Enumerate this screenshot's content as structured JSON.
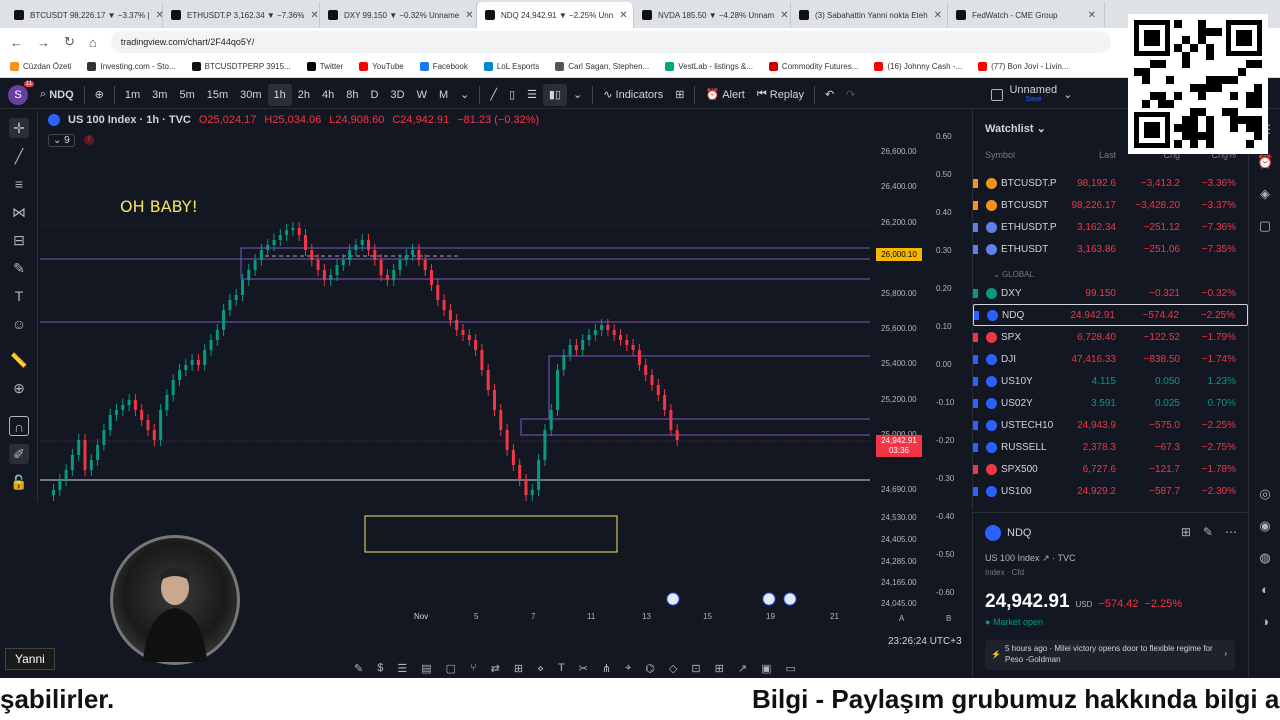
{
  "browser": {
    "tabs": [
      {
        "title": "BTCUSDT 98,226.17 ▼ −3.37% |",
        "active": false
      },
      {
        "title": "ETHUSDT.P 3,162.34 ▼ −7.36%",
        "active": false
      },
      {
        "title": "DXY 99.150 ▼ −0.32% Unname",
        "active": false
      },
      {
        "title": "NDQ 24,942.91 ▼ −2.25% Unn",
        "active": true
      },
      {
        "title": "NVDA 185.50 ▼ −4.28% Unnam",
        "active": false
      },
      {
        "title": "(3) Sabahattin Yanni nokta Eteh",
        "active": false
      },
      {
        "title": "FedWatch - CME Group",
        "active": false
      }
    ],
    "url": "tradingview.com/chart/2F44qo5Y/",
    "bookmarks": [
      "Cüzdan Özeti",
      "Investing.com - Sto...",
      "BTCUSDTPERP 3915...",
      "Twitter",
      "YouTube",
      "Facebook",
      "LoL Esports",
      "Carl Sagan, Stephen...",
      "VestLab - listings &...",
      "Commodity Futures...",
      "(16) Johnny Cash -...",
      "(77) Bon Jovi - Livin..."
    ]
  },
  "toolbar": {
    "avatar_letter": "S",
    "avatar_badge": "11",
    "symbol": "NDQ",
    "intervals": [
      "1m",
      "3m",
      "5m",
      "15m",
      "30m",
      "1h",
      "2h",
      "4h",
      "8h",
      "D",
      "3D",
      "W",
      "M"
    ],
    "selected_interval": "1h",
    "indicators_label": "Indicators",
    "alert_label": "Alert",
    "replay_label": "Replay",
    "layout_name": "Unnamed",
    "layout_status": "Save"
  },
  "chart": {
    "title": "US 100 Index · 1h · TVC",
    "ohlc": {
      "o": "O25,024.17",
      "h": "H25,034.06",
      "l": "L24,908.60",
      "c": "C24,942.91",
      "chg": "−81.23 (−0.32%)"
    },
    "indicator_count": "9",
    "annotation_text": "OH BABY!",
    "price_labels": [
      "26,600.00",
      "26,400.00",
      "26,200.00",
      "25,800.00",
      "25,600.00",
      "25,400.00",
      "25,200.00",
      "25,000.00",
      "24,690.00",
      "24,530.00",
      "24,405.00",
      "24,285.00",
      "24,165.00",
      "24,045.00"
    ],
    "pct_labels": [
      "0.60",
      "0.50",
      "0.40",
      "0.30",
      "0.20",
      "0.10",
      "0.00",
      "-0.10",
      "-0.20",
      "-0.30",
      "-0.40",
      "-0.50",
      "-0.60"
    ],
    "tag_level": "26,000.10",
    "tag_last_price": "24,942.91",
    "tag_countdown": "03:36",
    "time_labels": [
      "Nov",
      "5",
      "7",
      "11",
      "13",
      "15",
      "19",
      "21"
    ],
    "clock": "23:26:24 UTC+3",
    "colors": {
      "up": "#089981",
      "down": "#f23645",
      "box": "#7e57c2",
      "yellow": "#f5e663"
    }
  },
  "watchlist": {
    "title": "Watchlist",
    "columns": [
      "Symbol",
      "Last",
      "Chg",
      "Chg%"
    ],
    "global_label": "GLOBAL",
    "rows": [
      {
        "symbol": "BTCUSDT.P",
        "last": "98,192.6",
        "chg": "−3,413.2",
        "pct": "−3.36%",
        "dir": "neg",
        "icon": "#f7931a"
      },
      {
        "symbol": "BTCUSDT",
        "last": "98,226.17",
        "chg": "−3,428.20",
        "pct": "−3.37%",
        "dir": "neg",
        "icon": "#f7931a"
      },
      {
        "symbol": "ETHUSDT.P",
        "last": "3,162.34",
        "chg": "−251.12",
        "pct": "−7.36%",
        "dir": "neg",
        "icon": "#627eea"
      },
      {
        "symbol": "ETHUSDT",
        "last": "3,163.86",
        "chg": "−251.06",
        "pct": "−7.35%",
        "dir": "neg",
        "icon": "#627eea"
      },
      {
        "symbol": "DXY",
        "last": "99.150",
        "chg": "−0.321",
        "pct": "−0.32%",
        "dir": "neg",
        "icon": "#089981"
      },
      {
        "symbol": "NDQ",
        "last": "24,942.91",
        "chg": "−574.42",
        "pct": "−2.25%",
        "dir": "neg",
        "icon": "#2962ff"
      },
      {
        "symbol": "SPX",
        "last": "6,728.40",
        "chg": "−122.52",
        "pct": "−1.79%",
        "dir": "neg",
        "icon": "#f23645"
      },
      {
        "symbol": "DJI",
        "last": "47,416.33",
        "chg": "−838.50",
        "pct": "−1.74%",
        "dir": "neg",
        "icon": "#2962ff"
      },
      {
        "symbol": "US10Y",
        "last": "4.115",
        "chg": "0.050",
        "pct": "1.23%",
        "dir": "pos",
        "icon": "#2962ff"
      },
      {
        "symbol": "US02Y",
        "last": "3.591",
        "chg": "0.025",
        "pct": "0.70%",
        "dir": "pos",
        "icon": "#2962ff"
      },
      {
        "symbol": "USTECH10",
        "last": "24,943.9",
        "chg": "−575.0",
        "pct": "−2.25%",
        "dir": "neg",
        "icon": "#2962ff"
      },
      {
        "symbol": "RUSSELL",
        "last": "2,378.3",
        "chg": "−67.3",
        "pct": "−2.75%",
        "dir": "neg",
        "icon": "#2962ff"
      },
      {
        "symbol": "SPX500",
        "last": "6,727.6",
        "chg": "−121.7",
        "pct": "−1.78%",
        "dir": "neg",
        "icon": "#f23645"
      },
      {
        "symbol": "US100",
        "last": "24,929.2",
        "chg": "−587.7",
        "pct": "−2.30%",
        "dir": "neg",
        "icon": "#2962ff"
      }
    ]
  },
  "details": {
    "symbol": "NDQ",
    "name": "US 100 Index",
    "exchange": "TVC",
    "type": "Index · Cfd",
    "price": "24,942.91",
    "currency": "USD",
    "chg": "−574.42",
    "pct": "−2.25%",
    "market_status": "Market open",
    "news_time": "5 hours ago",
    "news_text": "Milei victory opens door to flexible regime for Peso -Goldman"
  },
  "overlay": {
    "streamer_name": "Yanni",
    "ticker_left": "şabilirler.",
    "ticker_right": "Bilgi - Paylaşım grubumuz hakkında bilgi aln"
  }
}
